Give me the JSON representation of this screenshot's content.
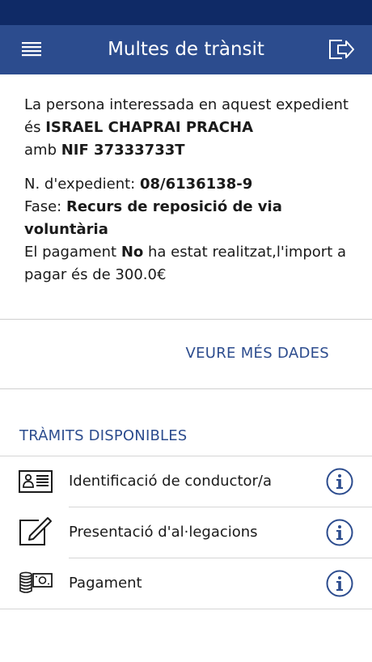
{
  "header": {
    "title": "Multes de trànsit",
    "menu_icon": "hamburger-menu-icon",
    "logout_icon": "logout-icon",
    "colors": {
      "status_bar": "#0f2a66",
      "app_bar": "#2c4c8e",
      "accent": "#2c4c8e"
    }
  },
  "info": {
    "line1_prefix": "La persona interessada en aquest expedient és ",
    "person_name": "ISRAEL CHAPRAI PRACHA",
    "line1_mid": "amb ",
    "nif": "NIF 37333733T",
    "expedient_label": "N. d'expedient: ",
    "expedient_number": "08/6136138-9",
    "fase_label": "Fase: ",
    "fase_value": "Recurs de reposició de via voluntària",
    "payment_prefix": "El pagament ",
    "payment_status": "No",
    "payment_suffix": " ha estat realitzat,l'import a pagar és de 300.0€"
  },
  "more_link": "VEURE MÉS DADES",
  "section_title": "TRÀMITS DISPONIBLES",
  "procedures": [
    {
      "label": "Identificació de conductor/a",
      "icon": "id-card-icon",
      "info_icon": "info-icon"
    },
    {
      "label": "Presentació d'al·legacions",
      "icon": "edit-document-icon",
      "info_icon": "info-icon"
    },
    {
      "label": "Pagament",
      "icon": "coins-banknote-icon",
      "info_icon": "info-icon"
    }
  ]
}
